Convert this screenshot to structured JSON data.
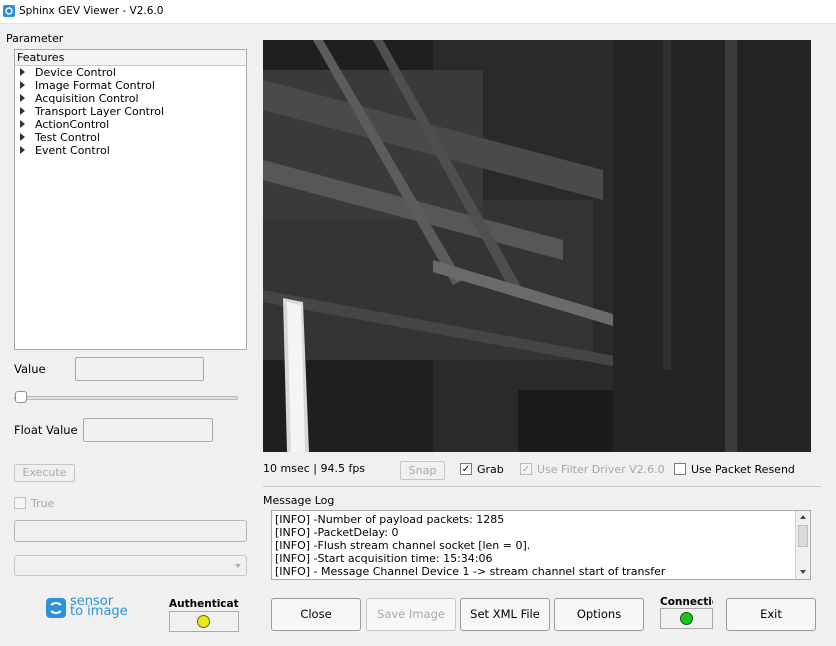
{
  "window": {
    "title": "Sphinx GEV Viewer -  V2.6.0"
  },
  "parameter_label": "Parameter",
  "features": {
    "header": "Features",
    "items": [
      "Device Control",
      "Image Format Control",
      "Acquisition Control",
      "Transport Layer Control",
      "ActionControl",
      "Test Control",
      "Event Control"
    ]
  },
  "value": {
    "label": "Value",
    "current": ""
  },
  "float_value": {
    "label": "Float Value",
    "current": ""
  },
  "execute_label": "Execute",
  "true_label": "True",
  "status": {
    "fps_text": "10 msec | 94.5 fps"
  },
  "controls": {
    "snap_label": "Snap",
    "grab_label": "Grab",
    "grab_checked": true,
    "filter_driver_label": "Use Filter Driver V2.6.0",
    "filter_driver_checked": true,
    "packet_resend_label": "Use Packet Resend",
    "packet_resend_checked": false
  },
  "message_log": {
    "label": "Message Log",
    "lines": [
      "[INFO] -Number of payload packets: 1285",
      "[INFO] -PacketDelay: 0",
      "[INFO] -Flush stream channel socket [len = 0].",
      "[INFO] -Start acquisition time: 15:34:06",
      "[INFO] - Message Channel Device 1 -> stream channel start of transfer"
    ]
  },
  "logo": {
    "line1": "sensor",
    "line2": "to image"
  },
  "authentication": {
    "label": "Authenticatic",
    "color": "#e8e81a"
  },
  "connection": {
    "label": "Connectio",
    "color": "#19c619"
  },
  "buttons": {
    "close": "Close",
    "save_image": "Save Image",
    "set_xml": "Set XML File",
    "options": "Options",
    "exit": "Exit"
  },
  "icons": {
    "app": "camera-app-icon",
    "tree_expander": "triangle-right-icon"
  }
}
